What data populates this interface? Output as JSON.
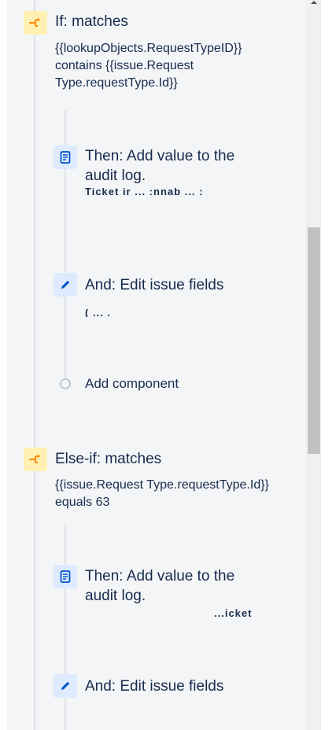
{
  "rule": {
    "if_block": {
      "title": "If: matches",
      "condition": "{{lookupObjects.RequestTypeID}} contains {{issue.Request Type.requestType.Id}}",
      "then": {
        "title": "Then: Add value to the audit log.",
        "detail": "Ticket ir  ...  :nnab ...  :"
      },
      "and": {
        "title": "And: Edit issue fields",
        "detail": "(  ...  ."
      },
      "add_component": "Add component"
    },
    "else_if_block": {
      "title": "Else-if: matches",
      "condition": "{{issue.Request Type.requestType.Id}} equals 63",
      "then": {
        "title": "Then: Add value to the audit log.",
        "detail": "...icket"
      },
      "and": {
        "title": "And: Edit issue fields"
      }
    }
  },
  "icons": {
    "condition": "branch-icon",
    "audit_log": "document-icon",
    "edit": "pencil-icon"
  },
  "colors": {
    "condition_bg": "#fff0b3",
    "condition_fg": "#ff8b00",
    "action_bg": "#deebff",
    "action_fg": "#0052cc"
  }
}
